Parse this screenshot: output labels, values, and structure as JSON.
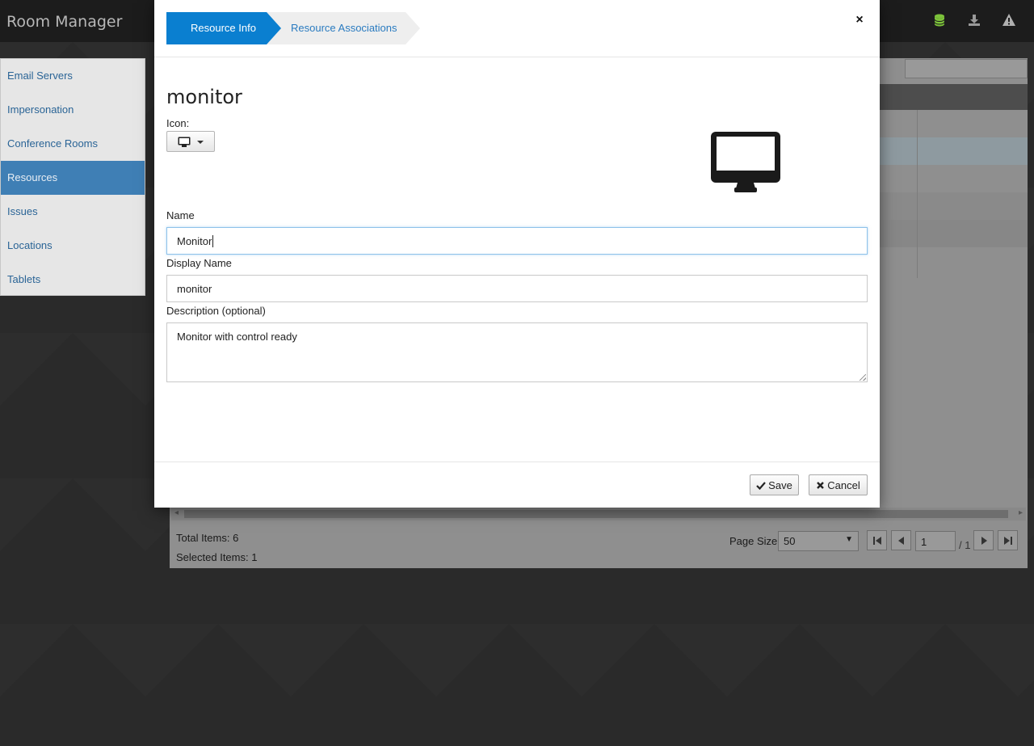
{
  "app": {
    "title": "Room Manager"
  },
  "top_icons": [
    "database-icon",
    "download-icon",
    "warning-icon"
  ],
  "sidebar": {
    "items": [
      {
        "label": "Email Servers",
        "active": false
      },
      {
        "label": "Impersonation",
        "active": false
      },
      {
        "label": "Conference Rooms",
        "active": false
      },
      {
        "label": "Resources",
        "active": true
      },
      {
        "label": "Issues",
        "active": false
      },
      {
        "label": "Locations",
        "active": false
      },
      {
        "label": "Tablets",
        "active": false
      }
    ]
  },
  "grid_footer": {
    "total_items": "Total Items: 6",
    "selected_items": "Selected Items: 1",
    "page_size_label": "Page Size:",
    "page_size_value": "50",
    "current_page": "1",
    "page_total": "/ 1"
  },
  "modal": {
    "wizard_steps": [
      {
        "label": "Resource Info",
        "active": true
      },
      {
        "label": "Resource Associations",
        "active": false
      }
    ],
    "close_label": "×",
    "resource_title": "monitor",
    "icon_label": "Icon:",
    "selected_icon": "monitor-icon",
    "name_label": "Name",
    "name_value": "Monitor",
    "display_name_label": "Display Name",
    "display_name_value": "monitor",
    "description_label": "Description (optional)",
    "description_value": "Monitor with control ready",
    "save_label": "Save",
    "cancel_label": "Cancel"
  },
  "colors": {
    "accent": "#0a7fd0",
    "sidebar_active": "#3f7fb5",
    "link": "#2a7bc0",
    "database_icon": "#7cc23a"
  }
}
